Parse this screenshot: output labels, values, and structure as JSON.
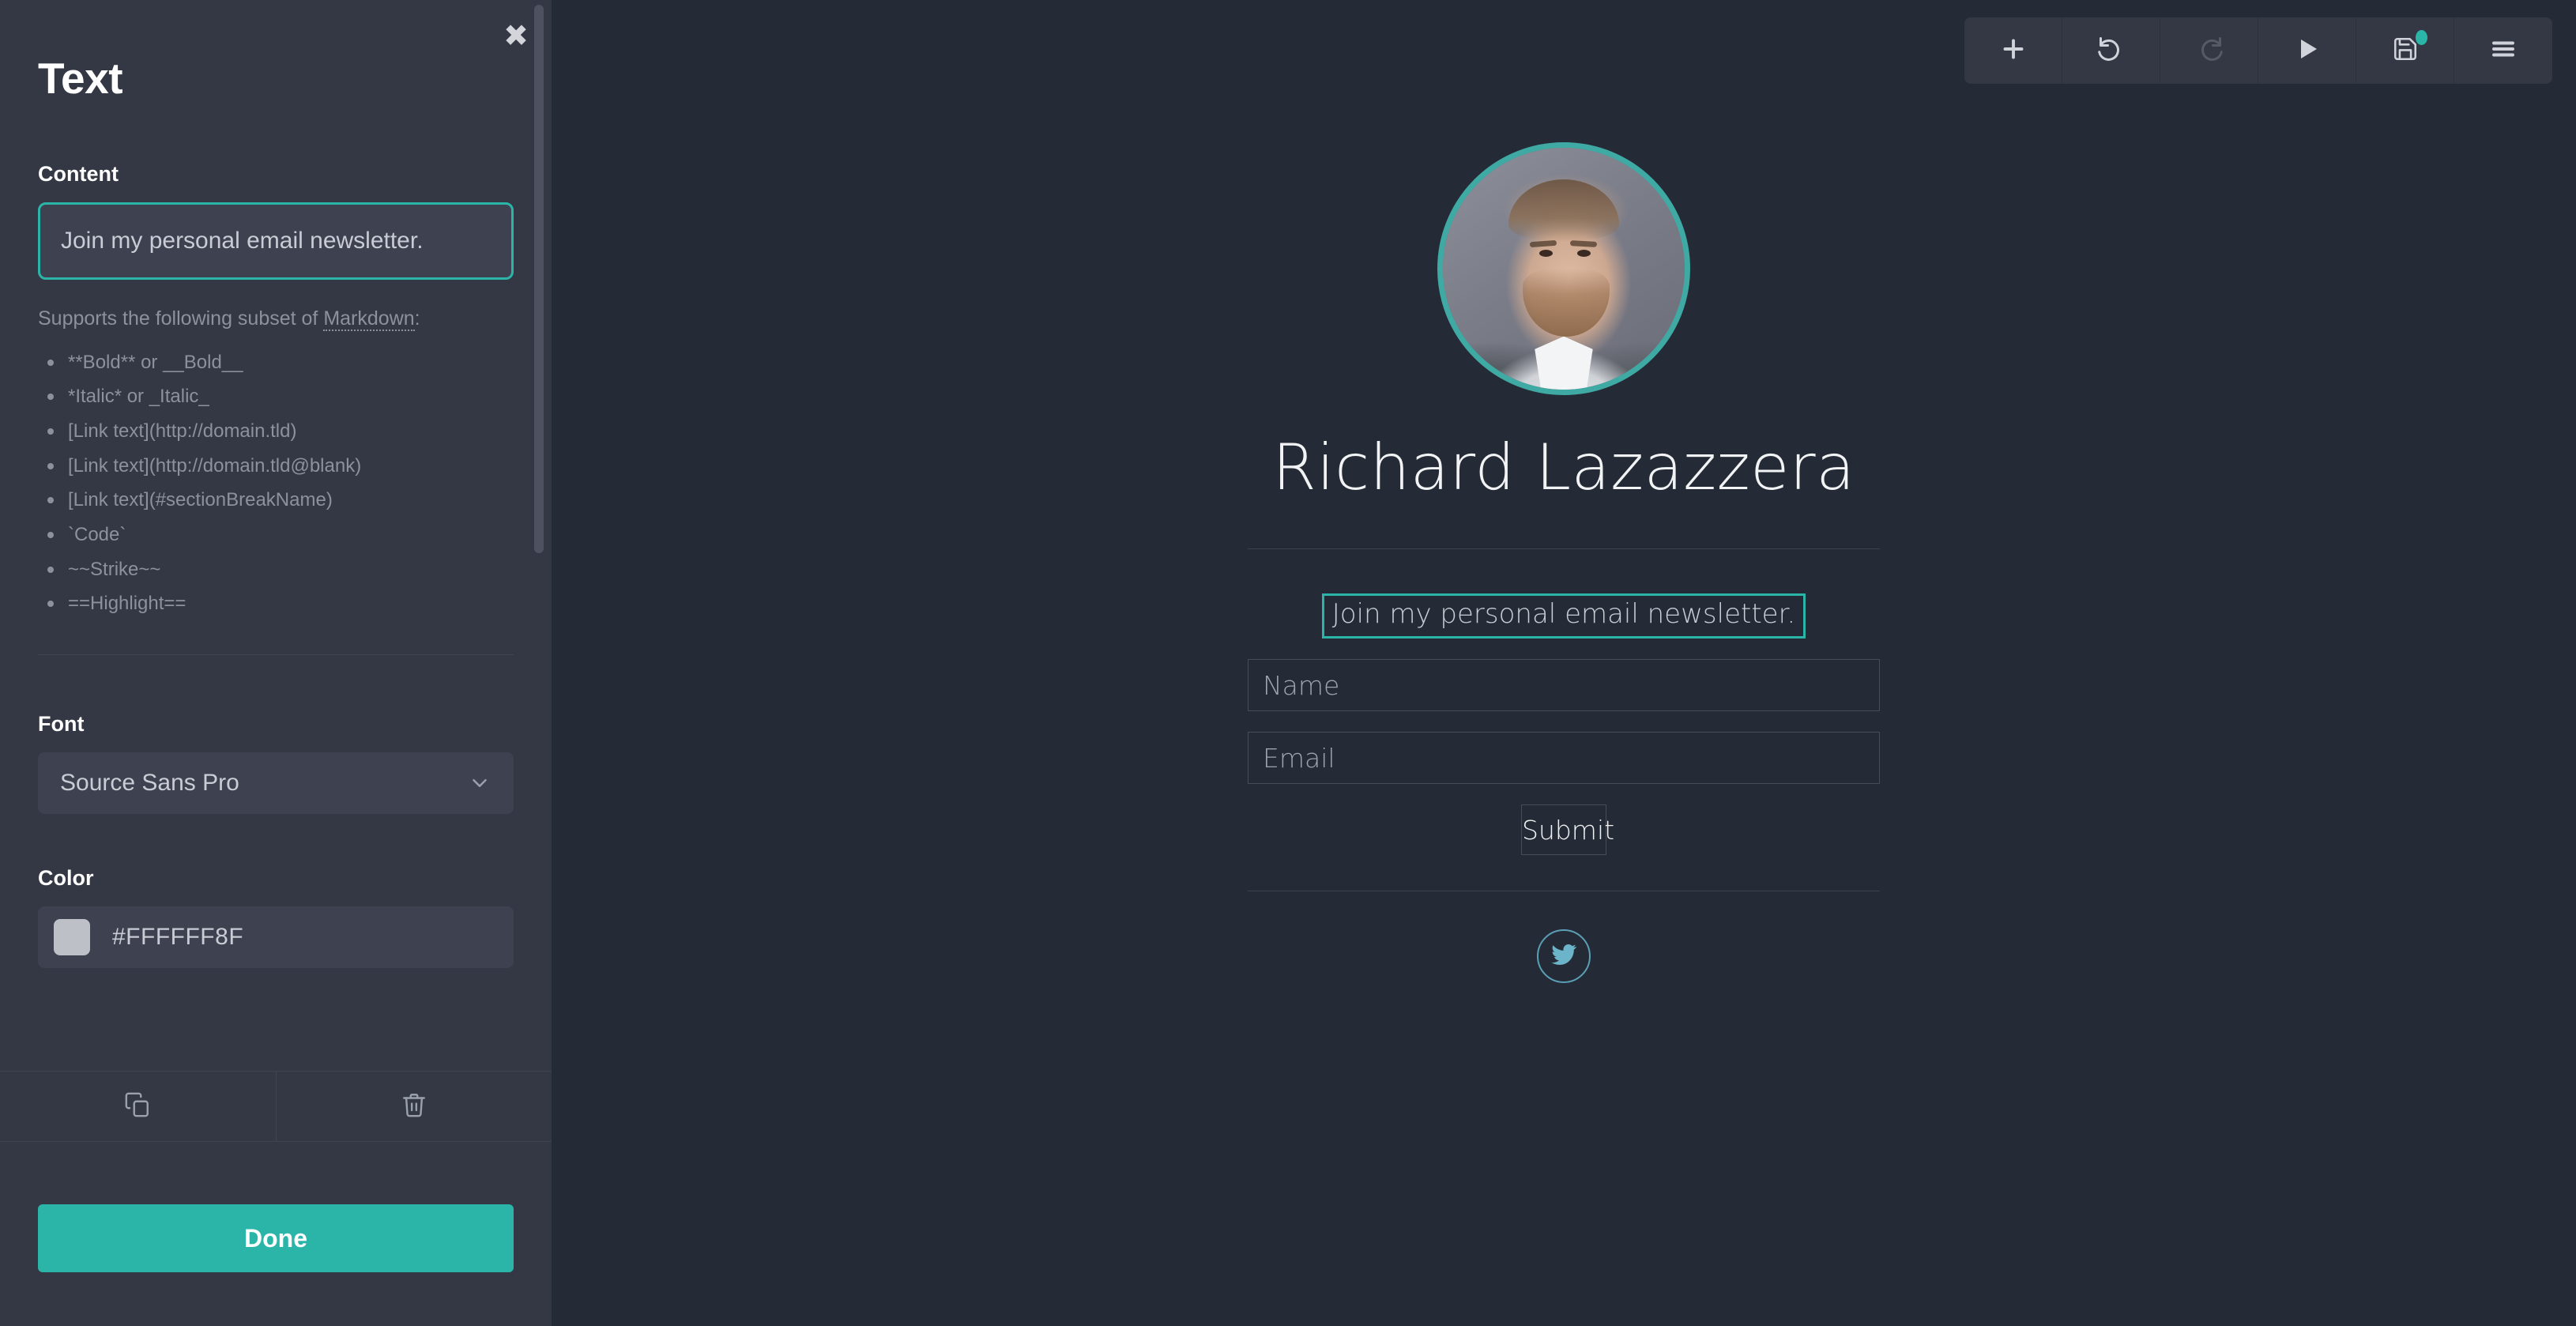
{
  "editor_panel": {
    "close_icon": "close-icon",
    "title": "Text",
    "content": {
      "label": "Content",
      "value": "Join my personal email newsletter.",
      "placeholder": ""
    },
    "markdown_help": {
      "intro_before": "Supports the following subset of ",
      "link": "Markdown",
      "intro_after": ":",
      "items": [
        "**Bold** or __Bold__",
        "*Italic* or _Italic_",
        "[Link text](http://domain.tld)",
        "[Link text](http://domain.tld@blank)",
        "[Link text](#sectionBreakName)",
        "`Code`",
        "~~Strike~~",
        "==Highlight=="
      ]
    },
    "font": {
      "label": "Font",
      "value": "Source Sans Pro",
      "chevron_icon": "chevron-down-icon"
    },
    "color": {
      "label": "Color",
      "value": "#FFFFFF8F",
      "swatch_hex": "#BDC0C7"
    },
    "action_bar": {
      "duplicate_icon": "duplicate-icon",
      "delete_icon": "trash-icon"
    },
    "done_label": "Done",
    "accent_color": "#2BB5A8",
    "panel_bg": "#343845"
  },
  "toolbar": {
    "buttons": [
      {
        "name": "add-button",
        "icon": "plus-icon",
        "disabled": false
      },
      {
        "name": "undo-button",
        "icon": "undo-icon",
        "disabled": false
      },
      {
        "name": "redo-button",
        "icon": "redo-icon",
        "disabled": true
      },
      {
        "name": "preview-button",
        "icon": "play-icon",
        "disabled": false
      },
      {
        "name": "save-button",
        "icon": "save-icon",
        "disabled": false
      },
      {
        "name": "menu-button",
        "icon": "hamburger-icon",
        "disabled": false
      }
    ],
    "save_badge_color": "#2BB5A8"
  },
  "canvas": {
    "background": "#252B36",
    "avatar": {
      "name": "avatar",
      "border_color": "#3FA9A4"
    },
    "profile_name": "Richard Lazazzera",
    "form": {
      "headline": "Join my personal email newsletter.",
      "name_placeholder": "Name",
      "email_placeholder": "Email",
      "name_value": "",
      "email_value": "",
      "submit_label": "Submit"
    },
    "social": {
      "twitter_icon": "twitter-icon",
      "twitter_color": "#6CB4C9"
    }
  }
}
